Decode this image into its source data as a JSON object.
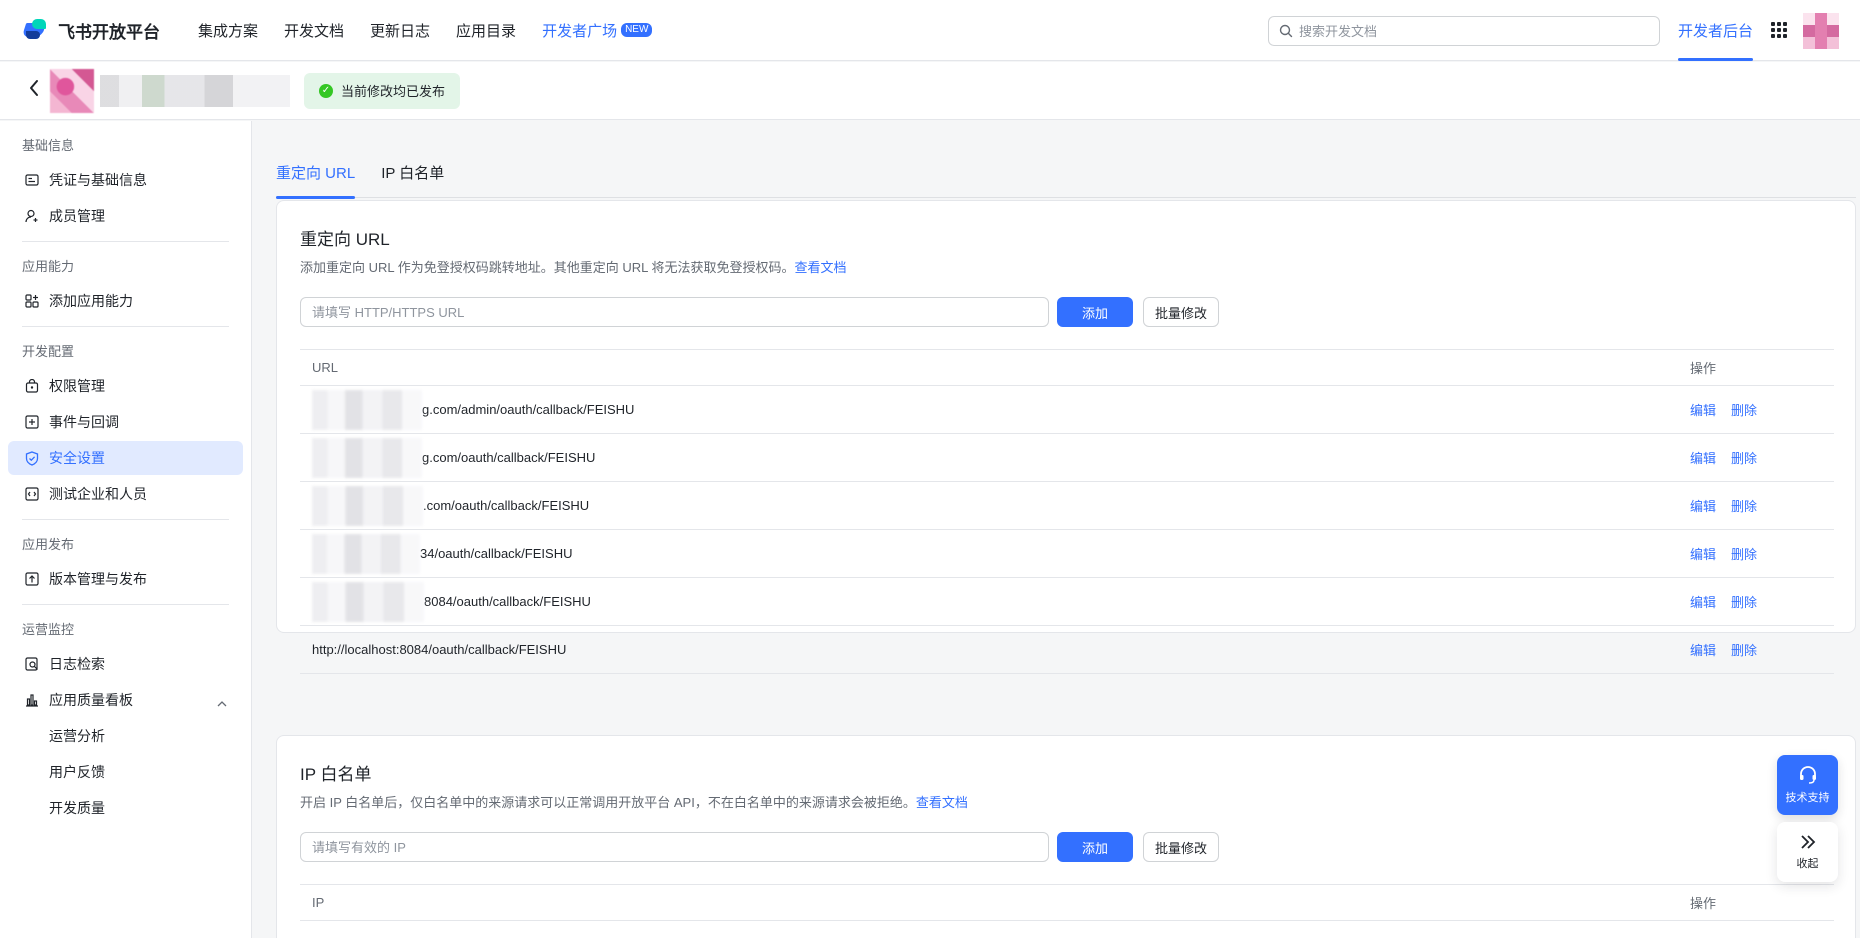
{
  "topbar": {
    "logo_text": "飞书开放平台",
    "nav": [
      {
        "label": "集成方案"
      },
      {
        "label": "开发文档"
      },
      {
        "label": "更新日志"
      },
      {
        "label": "应用目录"
      },
      {
        "label": "开发者广场",
        "badge": "NEW"
      }
    ],
    "search_placeholder": "搜索开发文档",
    "dev_backend": "开发者后台"
  },
  "subbar": {
    "status": "当前修改均已发布"
  },
  "sidebar": {
    "groups": [
      {
        "title": "基础信息",
        "items": [
          "凭证与基础信息",
          "成员管理"
        ]
      },
      {
        "title": "应用能力",
        "items": [
          "添加应用能力"
        ]
      },
      {
        "title": "开发配置",
        "items": [
          "权限管理",
          "事件与回调",
          "安全设置",
          "测试企业和人员"
        ]
      },
      {
        "title": "应用发布",
        "items": [
          "版本管理与发布"
        ]
      },
      {
        "title": "运营监控",
        "items": [
          "日志检索",
          "应用质量看板"
        ],
        "sub_items": [
          "运营分析",
          "用户反馈",
          "开发质量"
        ]
      }
    ],
    "active_item": "安全设置"
  },
  "tabs": [
    {
      "label": "重定向 URL",
      "active": true
    },
    {
      "label": "IP 白名单",
      "active": false
    }
  ],
  "redirect": {
    "title": "重定向 URL",
    "desc": "添加重定向 URL 作为免登授权码跳转地址。其他重定向 URL 将无法获取免登授权码。",
    "doc_link": "查看文档",
    "placeholder": "请填写 HTTP/HTTPS URL",
    "add_label": "添加",
    "batch_label": "批量修改",
    "col_url": "URL",
    "col_ops": "操作",
    "rows": [
      {
        "url": "g.com/admin/oauth/callback/FEISHU",
        "masked": true
      },
      {
        "url": "g.com/oauth/callback/FEISHU",
        "masked": true
      },
      {
        "url": ".com/oauth/callback/FEISHU",
        "masked": true
      },
      {
        "url": "34/oauth/callback/FEISHU",
        "masked": true
      },
      {
        "url": "8084/oauth/callback/FEISHU",
        "masked": true
      },
      {
        "url": "http://localhost:8084/oauth/callback/FEISHU",
        "masked": false
      }
    ],
    "edit_label": "编辑",
    "delete_label": "删除"
  },
  "ip": {
    "title": "IP 白名单",
    "desc": "开启 IP 白名单后，仅白名单中的来源请求可以正常调用开放平台 API，不在白名单中的来源请求会被拒绝。",
    "doc_link": "查看文档",
    "placeholder": "请填写有效的 IP",
    "add_label": "添加",
    "batch_label": "批量修改",
    "col_ip": "IP",
    "col_ops": "操作"
  },
  "float": {
    "support": "技术支持",
    "collapse": "收起"
  },
  "colors": {
    "accent": "#3370ff",
    "success": "#34c724",
    "active_bg": "#e1eaff"
  }
}
